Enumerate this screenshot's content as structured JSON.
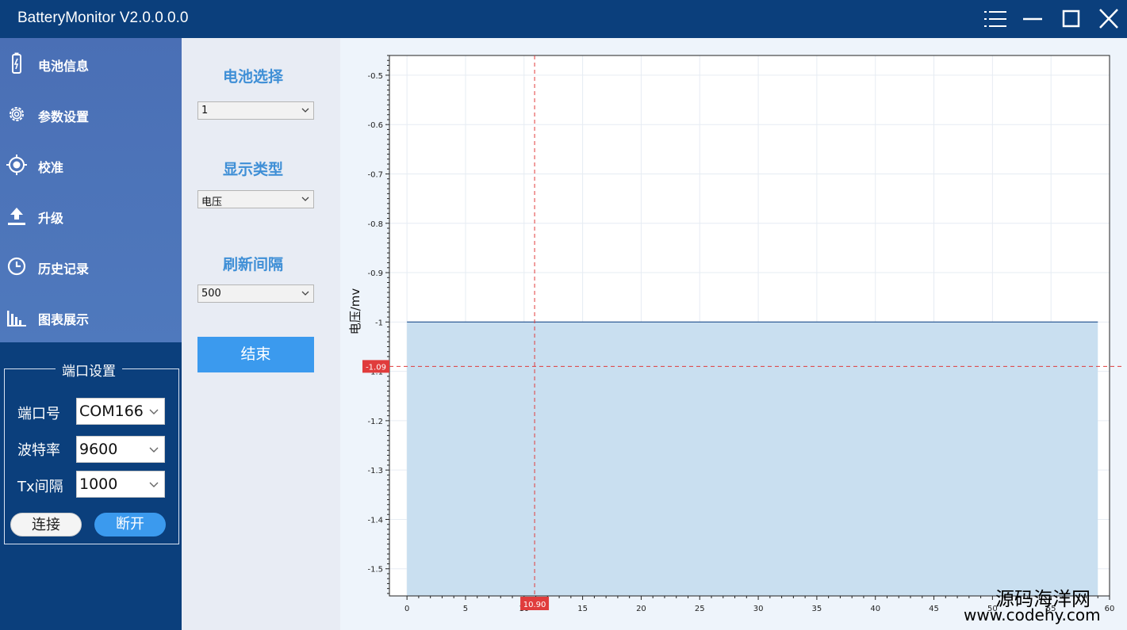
{
  "window": {
    "title": "BatteryMonitor V2.0.0.0.0"
  },
  "sidebar": {
    "items": [
      {
        "label": "电池信息",
        "icon": "battery-icon"
      },
      {
        "label": "参数设置",
        "icon": "gear-icon"
      },
      {
        "label": "校准",
        "icon": "target-icon"
      },
      {
        "label": "升级",
        "icon": "upload-icon"
      },
      {
        "label": "历史记录",
        "icon": "clock-icon"
      },
      {
        "label": "图表展示",
        "icon": "bar-chart-icon"
      }
    ]
  },
  "port_settings": {
    "legend": "端口设置",
    "port_label": "端口号",
    "port_value": "COM166",
    "baud_label": "波特率",
    "baud_value": "9600",
    "tx_label": "Tx间隔",
    "tx_value": "1000",
    "connect_label": "连接",
    "disconnect_label": "断开"
  },
  "panel": {
    "battery_select_label": "电池选择",
    "battery_select_value": "1",
    "display_type_label": "显示类型",
    "display_type_value": "电压",
    "refresh_label": "刷新间隔",
    "refresh_value": "500",
    "end_label": "结束"
  },
  "chart_data": {
    "type": "area",
    "ylabel": "电压/mv",
    "xlabel": "",
    "xlim": [
      -1.5,
      60
    ],
    "ylim": [
      -1.555,
      -0.46
    ],
    "x_ticks": [
      0,
      5,
      10,
      15,
      20,
      25,
      30,
      35,
      40,
      45,
      50,
      55,
      60
    ],
    "y_ticks": [
      -0.5,
      -0.6,
      -0.7,
      -0.8,
      -0.9,
      -1,
      -1.1,
      -1.2,
      -1.3,
      -1.4,
      -1.5
    ],
    "x_tick_labels": [
      "0",
      "5",
      "10",
      "15",
      "20",
      "25",
      "30",
      "35",
      "40",
      "45",
      "50",
      "55",
      "60"
    ],
    "y_tick_labels": [
      "-0.5",
      "-0.6",
      "-0.7",
      "-0.8",
      "-0.9",
      "-1",
      "-1.1",
      "-1.2",
      "-1.3",
      "-1.4",
      "-1.5"
    ],
    "series": [
      {
        "x": [
          0,
          59
        ],
        "y": [
          -1,
          -1
        ],
        "color": "#1f4e8c",
        "fill": "#c9dff0"
      }
    ],
    "crosshair": {
      "x": 10.9,
      "y": -1.09,
      "x_label": "10.90",
      "y_label": "-1.09",
      "color": "#e03c3c"
    },
    "grid": true
  },
  "watermark": {
    "line1": "源码海洋网",
    "line2": "www.codehy.com"
  }
}
